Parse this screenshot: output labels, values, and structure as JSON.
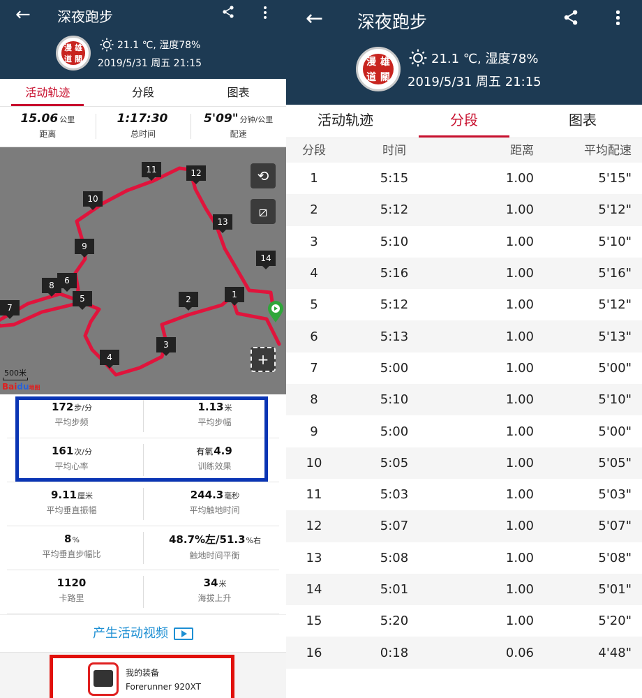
{
  "app": {
    "back_icon": "back-arrow-icon",
    "share_icon": "share-icon",
    "more_icon": "more-vert-icon"
  },
  "activity": {
    "title": "深夜跑步",
    "avatar_chars": [
      "漫",
      "雄",
      "道",
      "關"
    ],
    "weather_icon": "sun-icon",
    "weather": "21.1 ℃, 湿度78%",
    "datetime": "2019/5/31 周五 21:15"
  },
  "tabs": [
    "活动轨迹",
    "分段",
    "图表"
  ],
  "left_active_tab": 0,
  "right_active_tab": 1,
  "summary": [
    {
      "value": "15.06",
      "unit": "公里",
      "label": "距离"
    },
    {
      "value": "1:17:30",
      "unit": "",
      "label": "总时间"
    },
    {
      "value": "5'09\"",
      "unit": "分钟/公里",
      "label": "配速"
    }
  ],
  "map": {
    "km_markers": [
      "1",
      "2",
      "3",
      "4",
      "5",
      "6",
      "7",
      "8",
      "9",
      "10",
      "11",
      "12",
      "13",
      "14"
    ],
    "scale": "500米",
    "logo": {
      "a": "Bai",
      "b": "du",
      "c": "地图"
    },
    "buttons": {
      "loop": "⟲",
      "toggle": "⧄",
      "add": "+"
    }
  },
  "stats": [
    [
      {
        "prefix": "",
        "value": "172",
        "unit": "步/分",
        "label": "平均步频"
      },
      {
        "prefix": "",
        "value": "1.13",
        "unit": "米",
        "label": "平均步幅"
      }
    ],
    [
      {
        "prefix": "",
        "value": "161",
        "unit": "次/分",
        "label": "平均心率"
      },
      {
        "prefix": "有氧",
        "value": "4.9",
        "unit": "",
        "label": "训练效果"
      }
    ],
    [
      {
        "prefix": "",
        "value": "9.11",
        "unit": "厘米",
        "label": "平均垂直振幅"
      },
      {
        "prefix": "",
        "value": "244.3",
        "unit": "毫秒",
        "label": "平均触地时间"
      }
    ],
    [
      {
        "prefix": "",
        "value": "8",
        "unit": "%",
        "label": "平均垂直步幅比"
      },
      {
        "prefix": "",
        "value": "48.7%左/51.3",
        "unit": "%右",
        "label": "触地时间平衡"
      }
    ],
    [
      {
        "prefix": "",
        "value": "1120",
        "unit": "",
        "label": "卡路里"
      },
      {
        "prefix": "",
        "value": "34",
        "unit": "米",
        "label": "海拔上升"
      }
    ]
  ],
  "video_link": "产生活动视频",
  "gear": {
    "title": "我的装备",
    "name": "Forerunner 920XT"
  },
  "splits": {
    "headers": [
      "分段",
      "时间",
      "距离",
      "平均配速"
    ],
    "rows": [
      [
        "1",
        "5:15",
        "1.00",
        "5'15\""
      ],
      [
        "2",
        "5:12",
        "1.00",
        "5'12\""
      ],
      [
        "3",
        "5:10",
        "1.00",
        "5'10\""
      ],
      [
        "4",
        "5:16",
        "1.00",
        "5'16\""
      ],
      [
        "5",
        "5:12",
        "1.00",
        "5'12\""
      ],
      [
        "6",
        "5:13",
        "1.00",
        "5'13\""
      ],
      [
        "7",
        "5:00",
        "1.00",
        "5'00\""
      ],
      [
        "8",
        "5:10",
        "1.00",
        "5'10\""
      ],
      [
        "9",
        "5:00",
        "1.00",
        "5'00\""
      ],
      [
        "10",
        "5:05",
        "1.00",
        "5'05\""
      ],
      [
        "11",
        "5:03",
        "1.00",
        "5'03\""
      ],
      [
        "12",
        "5:07",
        "1.00",
        "5'07\""
      ],
      [
        "13",
        "5:08",
        "1.00",
        "5'08\""
      ],
      [
        "14",
        "5:01",
        "1.00",
        "5'01\""
      ],
      [
        "15",
        "5:20",
        "1.00",
        "5'20\""
      ],
      [
        "16",
        "0:18",
        "0.06",
        "4'48\""
      ]
    ]
  },
  "colors": {
    "header": "#1d3a53",
    "accent": "#c8102e",
    "route": "#e0143c",
    "link": "#1d8fd3"
  }
}
